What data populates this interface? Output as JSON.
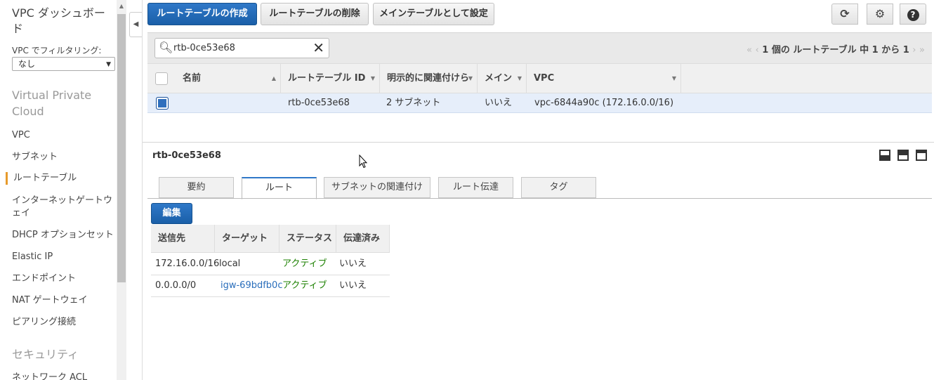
{
  "sidebar": {
    "title": "VPC ダッシュボード",
    "filter_label": "VPC でフィルタリング:",
    "filter_value": "なし",
    "section_vpc": "Virtual Private Cloud",
    "items": [
      "VPC",
      "サブネット",
      "ルートテーブル",
      "インターネットゲートウェイ",
      "DHCP オプションセット",
      "Elastic IP",
      "エンドポイント",
      "NAT ゲートウェイ",
      "ピアリング接続"
    ],
    "active_item": "ルートテーブル",
    "section_security": "セキュリティ",
    "partial_item": "ネットワーク ACL"
  },
  "toolbar": {
    "create_label": "ルートテーブルの作成",
    "delete_label": "ルートテーブルの削除",
    "set_main_label": "メインテーブルとして設定"
  },
  "filter": {
    "search_value": "rtb-0ce53e68",
    "pager_text": "1 個の ルートテーブル 中 1 から 1"
  },
  "table": {
    "headers": [
      "名前",
      "ルートテーブル ID",
      "明示的に関連付けら",
      "メイン",
      "VPC"
    ],
    "rows": [
      {
        "name": "",
        "id": "rtb-0ce53e68",
        "explicit": "2 サブネット",
        "main": "いいえ",
        "vpc": "vpc-6844a90c (172.16.0.0/16)"
      }
    ]
  },
  "details": {
    "title": "rtb-0ce53e68",
    "tabs": [
      "要約",
      "ルート",
      "サブネットの関連付け",
      "ルート伝達",
      "タグ"
    ],
    "active_tab": "ルート",
    "edit_label": "編集",
    "routes_headers": [
      "送信先",
      "ターゲット",
      "ステータス",
      "伝達済み"
    ],
    "routes": [
      {
        "dest": "172.16.0.0/16",
        "target": "local",
        "status": "アクティブ",
        "propagated": "いいえ"
      },
      {
        "dest": "0.0.0.0/0",
        "target": "igw-69bdfb0c",
        "status": "アクティブ",
        "propagated": "いいえ"
      }
    ]
  },
  "colors": {
    "primary": "#2f78c8",
    "active_nav": "#e79b2c",
    "status_green": "#1d8102",
    "link_blue": "#2a6ebb"
  }
}
